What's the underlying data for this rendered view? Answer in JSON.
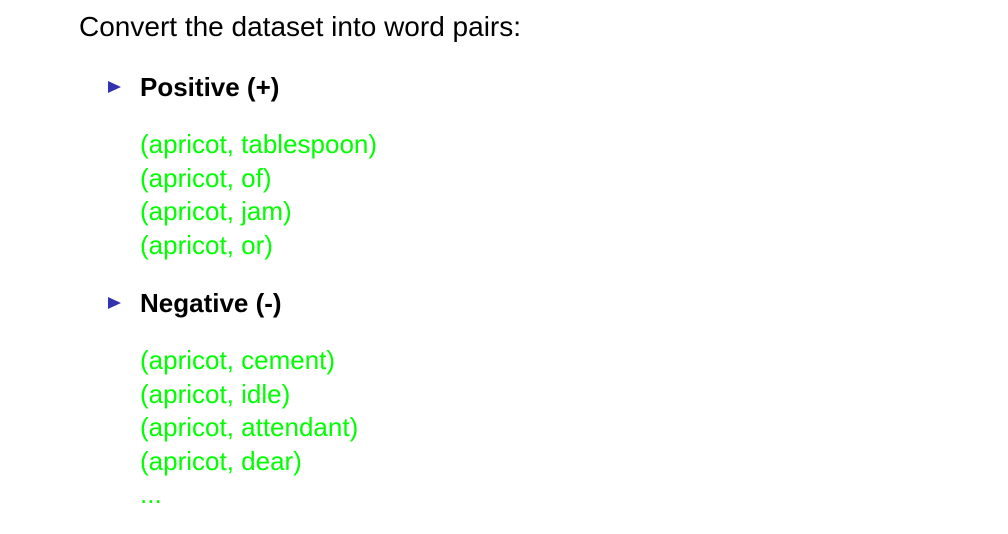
{
  "intro": "Convert the dataset into word pairs:",
  "positive": {
    "title": "Positive (+)",
    "pairs": [
      "(apricot, tablespoon)",
      "(apricot, of)",
      "(apricot, jam)",
      "(apricot, or)"
    ]
  },
  "negative": {
    "title": "Negative (-)",
    "pairs": [
      "(apricot, cement)",
      "(apricot, idle)",
      "(apricot, attendant)",
      "(apricot, dear)"
    ],
    "ellipsis": "..."
  },
  "colors": {
    "bullet": "#3333b2",
    "pair_text": "#00ff00",
    "heading_text": "#000000"
  },
  "icons": {
    "bullet": "triangle-right-icon"
  }
}
